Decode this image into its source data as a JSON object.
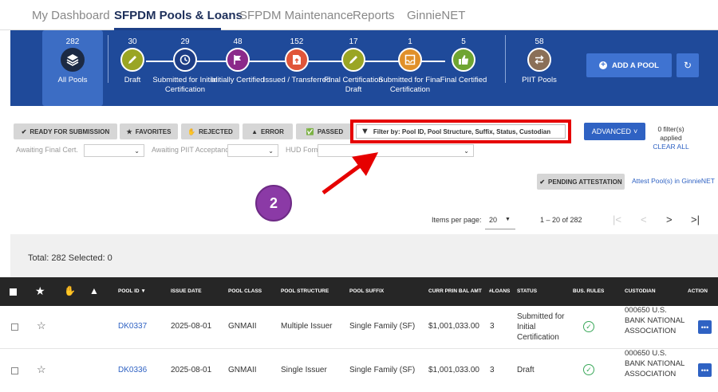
{
  "nav": {
    "tabs": [
      {
        "label": "My Dashboard"
      },
      {
        "label": "SFPDM Pools & Loans"
      },
      {
        "label": "SFPDM Maintenance"
      },
      {
        "label": "Reports"
      },
      {
        "label": "GinnieNET"
      }
    ],
    "active_tab": "SFPDM Pools & Loans"
  },
  "stages": [
    {
      "count": "282",
      "label": "All Pools",
      "icon": "layers-icon",
      "color": "#1c2a44"
    },
    {
      "count": "30",
      "label": "Draft",
      "icon": "pencil-icon",
      "color": "#9aa524"
    },
    {
      "count": "29",
      "label": "Submitted for Initial Certification",
      "icon": "clock-icon",
      "color": "#1d3d86"
    },
    {
      "count": "48",
      "label": "Initially Certified",
      "icon": "flag-icon",
      "color": "#8b2a8a"
    },
    {
      "count": "152",
      "label": "Issued / Transferred",
      "icon": "document-upload-icon",
      "color": "#e0563a"
    },
    {
      "count": "17",
      "label": "Final Certification Draft",
      "icon": "pencil-icon",
      "color": "#9aa524"
    },
    {
      "count": "1",
      "label": "Submitted for Final Certification",
      "icon": "inbox-icon",
      "color": "#e0902a"
    },
    {
      "count": "5",
      "label": "Final Certified",
      "icon": "thumbs-up-icon",
      "color": "#6fa532"
    },
    {
      "count": "58",
      "label": "PIIT Pools",
      "icon": "swap-icon",
      "color": "#8a6f58"
    }
  ],
  "actions": {
    "add_pool": "ADD A POOL",
    "refresh_icon": "refresh-icon"
  },
  "filters": {
    "buttons": [
      {
        "label": "READY FOR SUBMISSION",
        "icon": "check-icon"
      },
      {
        "label": "FAVORITES",
        "icon": "star-icon"
      },
      {
        "label": "REJECTED",
        "icon": "thumbs-down-icon"
      },
      {
        "label": "ERROR",
        "icon": "warning-icon"
      },
      {
        "label": "PASSED",
        "icon": "check-circle-icon"
      }
    ],
    "search_placeholder": "Filter by: Pool ID, Pool Structure, Suffix, Status, Custodian",
    "advanced": "ADVANCED",
    "applied": "0 filter(s) applied",
    "clear_all": "CLEAR ALL",
    "dropdowns": [
      {
        "label": "Awaiting Final Cert."
      },
      {
        "label": "Awaiting PIIT Acceptance"
      },
      {
        "label": "HUD Forms"
      }
    ]
  },
  "middle": {
    "pending": "PENDING ATTESTATION",
    "attest_link": "Attest Pool(s) in GinnieNET",
    "callout_number": "2",
    "items_per_page_label": "Items per page:",
    "items_per_page": "20",
    "range": "1 – 20 of 282",
    "pager": [
      "|<",
      "<",
      ">",
      ">|"
    ]
  },
  "table": {
    "total": "Total: 282 Selected: 0",
    "columns": [
      "POOL ID",
      "ISSUE DATE",
      "POOL CLASS",
      "POOL STRUCTURE",
      "POOL SUFFIX",
      "CURR PRIN BAL AMT",
      "#LOANS",
      "STATUS",
      "BUS. RULES",
      "CUSTODIAN",
      "ACTION"
    ],
    "rows": [
      {
        "pool_id": "DK0337",
        "issue_date": "2025-08-01",
        "pool_class": "GNMAII",
        "structure": "Multiple Issuer",
        "suffix": "Single Family (SF)",
        "balance": "$1,001,033.00",
        "loans": "3",
        "status": "Submitted for Initial Certification",
        "custodian": "000650 U.S. BANK NATIONAL ASSOCIATION"
      },
      {
        "pool_id": "DK0336",
        "issue_date": "2025-08-01",
        "pool_class": "GNMAII",
        "structure": "Single Issuer",
        "suffix": "Single Family (SF)",
        "balance": "$1,001,033.00",
        "loans": "3",
        "status": "Draft",
        "custodian": "000650 U.S. BANK NATIONAL ASSOCIATION"
      }
    ]
  },
  "colors": {
    "band": "#1f4a9a",
    "highlight": "#e60000",
    "callout": "#8b3aa6",
    "accent": "#2f62c3"
  }
}
